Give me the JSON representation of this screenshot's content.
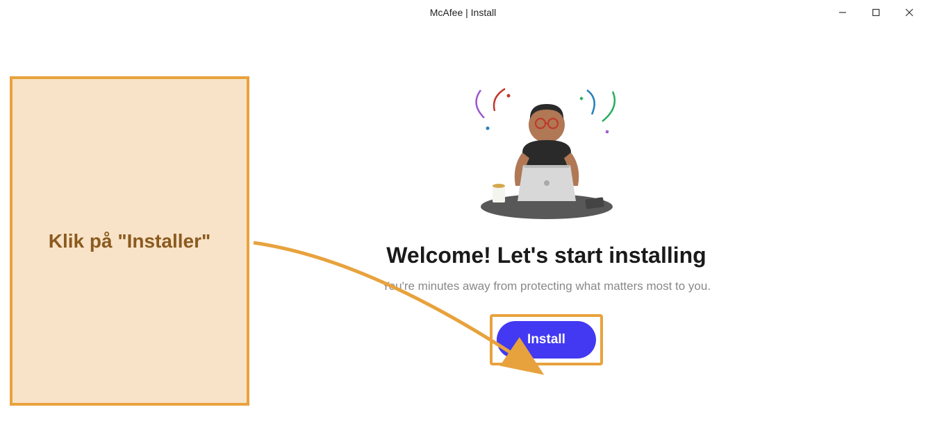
{
  "window": {
    "title": "McAfee | Install"
  },
  "content": {
    "heading": "Welcome! Let's start installing",
    "subheading": "You're minutes away from protecting what matters most to you.",
    "install_button_label": "Install"
  },
  "annotation": {
    "callout_text": "Klik på \"Installer\"",
    "callout_color": "#e8a23d",
    "callout_bg": "#f8e3c8",
    "callout_text_color": "#8b5a1f"
  },
  "icons": {
    "minimize": "minimize-icon",
    "maximize": "maximize-icon",
    "close": "close-icon"
  }
}
